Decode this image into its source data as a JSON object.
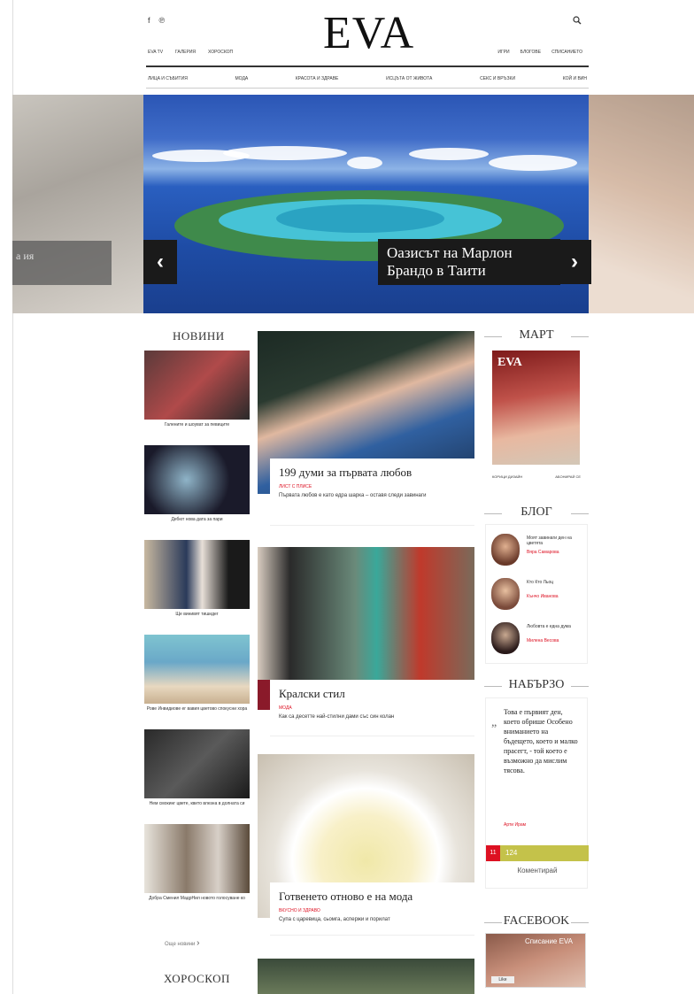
{
  "header": {
    "social": [
      "f",
      "℗"
    ],
    "logo": "EVA",
    "top_links_left": [
      "EVA TV",
      "ГАЛЕРИЯ",
      "ХОРОСКОП"
    ],
    "top_links_right": [
      "ИГРИ",
      "БЛОГОВЕ",
      "СПИСАНИЕТО"
    ],
    "nav": [
      "ЛИЦА И СЪБИТИЯ",
      "МОДА",
      "КРАСОТА И ЗДРАВЕ",
      "ИСЦЪТА ОТ ЖИВОТА",
      "СЕКС И ВРЪЗКИ",
      "КОЙ И ВИН"
    ]
  },
  "hero": {
    "caption_line1": "Оазисът на Марлон",
    "caption_line2": "Брандо в Таити",
    "left_ghost": "а\nия",
    "prev": "‹",
    "next": "›",
    "colors": {
      "sky": "#2b56b5",
      "lagoon": "#46c3d6"
    }
  },
  "left": {
    "title": "НОВИНИ",
    "items": [
      {
        "text": "Галените и шоуват за певиците"
      },
      {
        "text": "Дебют нова дата за пари"
      },
      {
        "text": "Ще винивят тишидег"
      },
      {
        "text": "Рове Инвидиове ег вавия цветово спокусни хора"
      },
      {
        "text": "Нем смокинг цвете, квито влезна в долната си"
      },
      {
        "text": "Добра Сменил МадрНил новото голосуване ко"
      }
    ],
    "all_link": "Още новини",
    "horoscope": "ХОРОСКОП"
  },
  "center": {
    "articles": [
      {
        "title": "199 думи за първата любов",
        "cat": "ЛИСТ С ПЛИСЕ",
        "desc": "Първата любов е като едра шарка – оставя следи завинаги"
      },
      {
        "title": "Кралски стил",
        "cat": "МОДА",
        "desc": "Как са десетте най-стилни дами със син колан"
      },
      {
        "title": "Готвенето отново е на мода",
        "cat": "ВКУСНО И ЗДРАВО",
        "desc": "Супа с царевица, сьомга, аспержи и порилат"
      }
    ]
  },
  "right": {
    "march": "МАРТ",
    "magazine": "EVA",
    "cover_links": [
      "КОРИЦИ ДИЗАЙН",
      "АБОНИРАЙ СЕ"
    ],
    "blog_title": "БЛОГ",
    "blogs": [
      {
        "name": "Моят завинаги ден на цветята",
        "author": "Вяра Самарова"
      },
      {
        "name": "Кто Кто Льоц",
        "author": "Кънчо Иванова"
      },
      {
        "name": "Любовта е една дума",
        "author": "Милена Весова"
      }
    ],
    "quick_title": "НАБЪРЗО",
    "quote": "„",
    "quick_text": "Това е първият ден, което обрише Особено вниманието на бъдещето, което и малко прасегт, - той което е възможно да мислим тясова.",
    "quick_author": "Арти Ирам",
    "poll_num": "11",
    "poll_count": "124",
    "comment": "Коментирай",
    "facebook": "FACEBOOK",
    "fb_label": "Списание EVA",
    "fb_like": "Like"
  }
}
